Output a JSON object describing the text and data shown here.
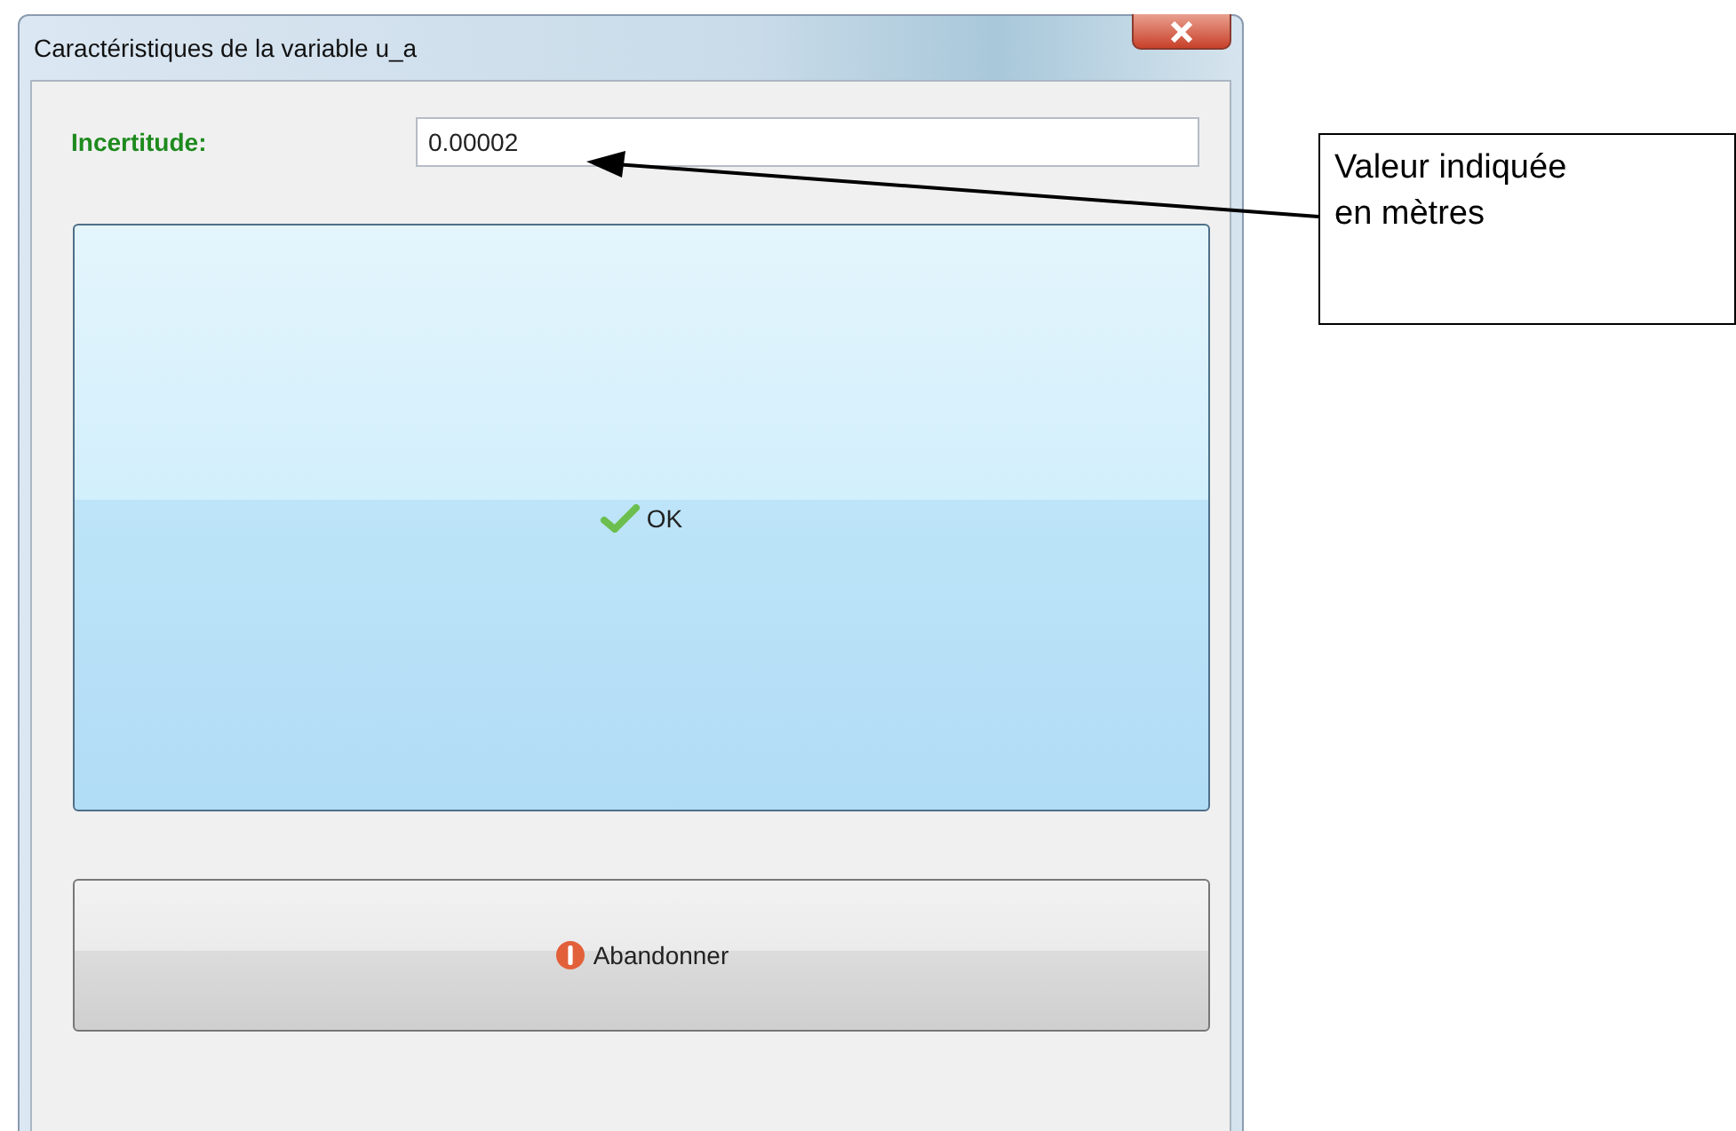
{
  "window": {
    "title": "Caractéristiques de la variable u_a"
  },
  "field": {
    "label": "Incertitude:",
    "value": "0.00002"
  },
  "buttons": [
    {
      "kind": "ok",
      "label": "OK"
    },
    {
      "kind": "cancel",
      "label": "Abandonner"
    }
  ],
  "annotation": {
    "lines": [
      "Valeur indiquée",
      "en mètres"
    ]
  }
}
